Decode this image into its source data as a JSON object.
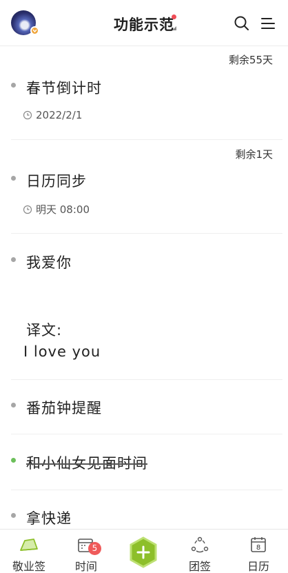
{
  "header": {
    "title": "功能示范",
    "title_dot_color": "#f04d57",
    "search_icon": "search-icon",
    "menu_icon": "menu-lines-icon"
  },
  "items": [
    {
      "title": "春节倒计时",
      "remaining": "剩余55天",
      "meta": "2022/2/1",
      "bullet_color": "#a6a6a6",
      "completed": false
    },
    {
      "title": "日历同步",
      "remaining": "剩余1天",
      "meta": "明天 08:00",
      "bullet_color": "#a6a6a6",
      "completed": false
    },
    {
      "title": "我爱你",
      "note_label": "译文:",
      "note_text": "I love you",
      "bullet_color": "#a6a6a6",
      "completed": false
    },
    {
      "title": "番茄钟提醒",
      "bullet_color": "#a6a6a6",
      "completed": false
    },
    {
      "title": "和小仙女见面时间",
      "bullet_color": "#6cbf5a",
      "completed": true
    },
    {
      "title": "拿快递",
      "bullet_color": "#a6a6a6",
      "completed": false
    }
  ],
  "bottom_nav": {
    "items": [
      {
        "label": "敬业签",
        "icon": "notes-icon",
        "active": true
      },
      {
        "label": "时间",
        "icon": "time-calendar-icon",
        "badge": "5"
      },
      {
        "label": "",
        "icon": "add-icon"
      },
      {
        "label": "团签",
        "icon": "team-icon"
      },
      {
        "label": "日历",
        "icon": "calendar-icon",
        "icon_text": "8"
      }
    ],
    "accent": "#8dbf2a",
    "badge_color": "#ef5a5a"
  }
}
